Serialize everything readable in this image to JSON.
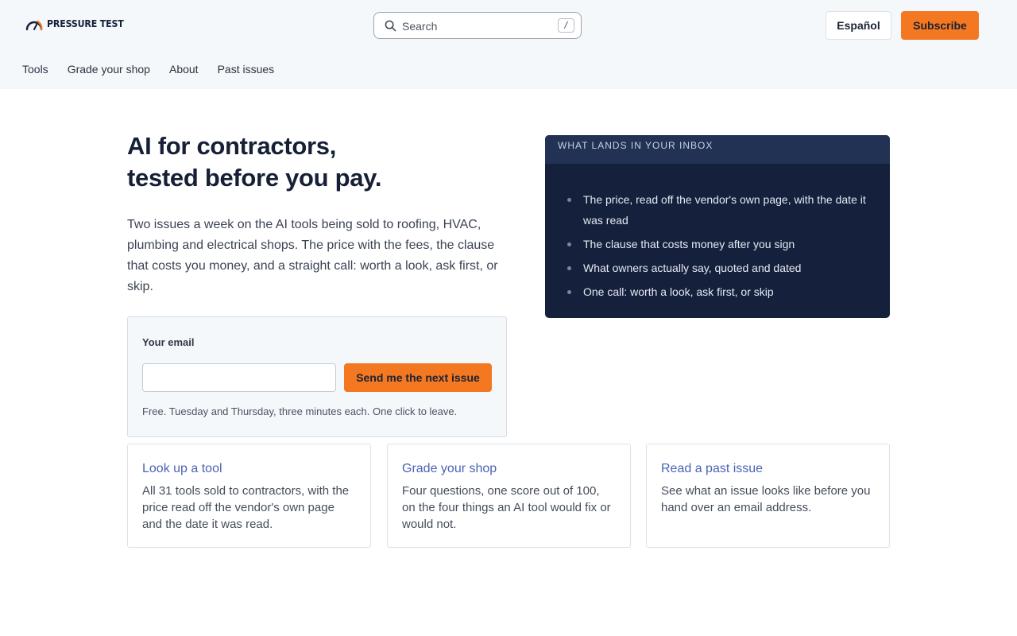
{
  "brand": {
    "name": "PRESSURE TEST",
    "accent": "#f47722",
    "navy": "#15213c"
  },
  "header": {
    "search_placeholder": "Search",
    "search_shortcut": "/",
    "language_button": "Español",
    "subscribe_button": "Subscribe",
    "nav": [
      "Tools",
      "Grade your shop",
      "About",
      "Past issues"
    ]
  },
  "hero": {
    "title_line1": "AI for contractors,",
    "title_line2": "tested before you pay.",
    "description": "Two issues a week on the AI tools being sold to roofing, HVAC, plumbing and electrical shops. The price with the fees, the clause that costs you money, and a straight call: worth a look, ask first, or skip."
  },
  "inbox": {
    "heading": "WHAT LANDS IN YOUR INBOX",
    "items": [
      "The price, read off the vendor's own page, with the date it was read",
      "The clause that costs money after you sign",
      "What owners actually say, quoted and dated",
      "One call: worth a look, ask first, or skip"
    ]
  },
  "signup": {
    "label": "Your email",
    "email_value": "",
    "button": "Send me the next issue",
    "note": "Free. Tuesday and Thursday, three minutes each. One click to leave."
  },
  "cards": [
    {
      "title": "Look up a tool",
      "text": "All 31 tools sold to contractors, with the price read off the vendor's own page and the date it was read."
    },
    {
      "title": "Grade your shop",
      "text": "Four questions, one score out of 100, on the four things an AI tool would fix or would not."
    },
    {
      "title": "Read a past issue",
      "text": "See what an issue looks like before you hand over an email address."
    }
  ]
}
